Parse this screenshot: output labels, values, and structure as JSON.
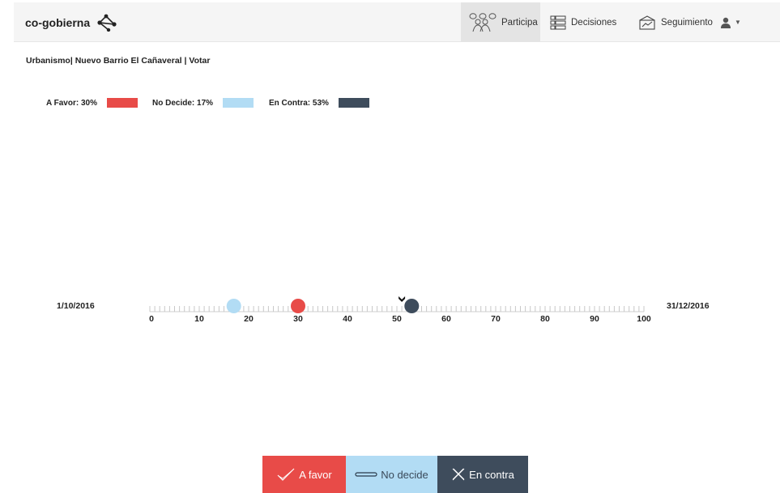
{
  "navbar": {
    "brand": "co-gobierna",
    "items": [
      {
        "label": "Participa",
        "icon": "people-group-icon",
        "active": true
      },
      {
        "label": "Decisiones",
        "icon": "list-icon"
      },
      {
        "label": "Seguimiento",
        "icon": "chart-icon"
      }
    ],
    "user_icon": "user-icon"
  },
  "breadcrumb": "Urbanismo| Nuevo Barrio El Cañaveral | Votar",
  "legend": [
    {
      "label": "A Favor: 30%",
      "color": "#e84b48"
    },
    {
      "label": "No Decide: 17%",
      "color": "#b2dcf4"
    },
    {
      "label": "En Contra: 53%",
      "color": "#3e4c5c"
    }
  ],
  "scale": {
    "start_date": "1/10/2016",
    "end_date": "31/12/2016",
    "tick_labels": [
      "0",
      "10",
      "20",
      "30",
      "40",
      "50",
      "60",
      "70",
      "80",
      "90",
      "100"
    ],
    "markers": [
      {
        "name": "no-decide",
        "value": 17,
        "color": "#b2dcf4"
      },
      {
        "name": "a-favor",
        "value": 30,
        "color": "#e84b48"
      },
      {
        "name": "en-contra",
        "value": 53,
        "color": "#3e4c5c"
      }
    ],
    "pointer_value": 51
  },
  "vote_buttons": {
    "favor": "A favor",
    "nodecide": "No decide",
    "contra": "En contra"
  }
}
